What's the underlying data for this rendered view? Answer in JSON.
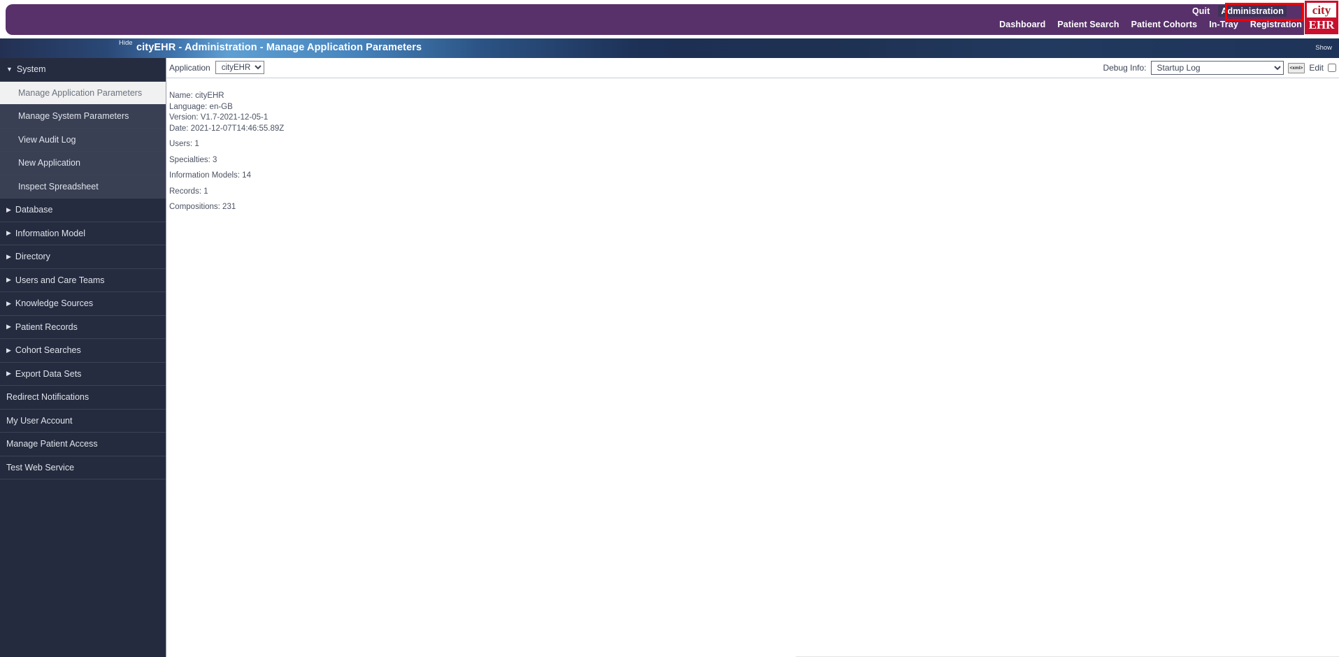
{
  "app": {
    "window_title": "cityEHR - Administration - Manage Application Parameters"
  },
  "banner": {
    "top_links": [
      {
        "label": "Quit",
        "selected": false
      },
      {
        "label": "Administration",
        "selected": true
      }
    ],
    "bottom_links": [
      {
        "label": "Dashboard"
      },
      {
        "label": "Patient Search"
      },
      {
        "label": "Patient Cohorts"
      },
      {
        "label": "In-Tray"
      },
      {
        "label": "Registration"
      }
    ],
    "logo": {
      "top_text": "city",
      "bottom_text": "EHR",
      "red": "#c8102e"
    },
    "background": "#58316b",
    "highlight_color": "#f60000"
  },
  "titlebar": {
    "hide_label": "Hide",
    "show_label": "Show",
    "title": "cityEHR - Administration - Manage Application Parameters"
  },
  "sidebar": {
    "items": [
      {
        "label": "System",
        "type": "group",
        "icon": "triangle-down-icon",
        "expanded": true
      },
      {
        "label": "Manage Application Parameters",
        "type": "child",
        "active": true
      },
      {
        "label": "Manage System Parameters",
        "type": "child",
        "active": false
      },
      {
        "label": "View Audit Log",
        "type": "child",
        "active": false
      },
      {
        "label": "New Application",
        "type": "child",
        "active": false
      },
      {
        "label": "Inspect Spreadsheet",
        "type": "child",
        "active": false
      },
      {
        "label": "Database",
        "type": "group",
        "icon": "triangle-right-icon",
        "expanded": false
      },
      {
        "label": "Information Model",
        "type": "group",
        "icon": "triangle-right-icon",
        "expanded": false
      },
      {
        "label": "Directory",
        "type": "group",
        "icon": "triangle-right-icon",
        "expanded": false
      },
      {
        "label": "Users and Care Teams",
        "type": "group",
        "icon": "triangle-right-icon",
        "expanded": false
      },
      {
        "label": "Knowledge Sources",
        "type": "group",
        "icon": "triangle-right-icon",
        "expanded": false
      },
      {
        "label": "Patient Records",
        "type": "group",
        "icon": "triangle-right-icon",
        "expanded": false
      },
      {
        "label": "Cohort Searches",
        "type": "group",
        "icon": "triangle-right-icon",
        "expanded": false
      },
      {
        "label": "Export Data Sets",
        "type": "group",
        "icon": "triangle-right-icon",
        "expanded": false
      },
      {
        "label": "Redirect Notifications",
        "type": "plain"
      },
      {
        "label": "My User Account",
        "type": "plain"
      },
      {
        "label": "Manage Patient Access",
        "type": "plain"
      },
      {
        "label": "Test Web Service",
        "type": "plain"
      }
    ]
  },
  "toolbar": {
    "application_label": "Application",
    "application_value": "cityEHR",
    "application_options": [
      "cityEHR"
    ],
    "debug_label": "Debug Info:",
    "debug_value": "Startup Log",
    "debug_options": [
      "Startup Log"
    ],
    "xml_button_label": "<xml>",
    "edit_label": "Edit",
    "edit_checked": false
  },
  "content": {
    "lines": [
      "Name: cityEHR",
      "Language: en-GB",
      "Version: V1.7-2021-12-05-1",
      "Date: 2021-12-07T14:46:55.89Z"
    ],
    "stats": [
      "Users: 1",
      "Specialties: 3",
      "Information Models: 14",
      "Records: 1",
      "Compositions: 231"
    ]
  }
}
